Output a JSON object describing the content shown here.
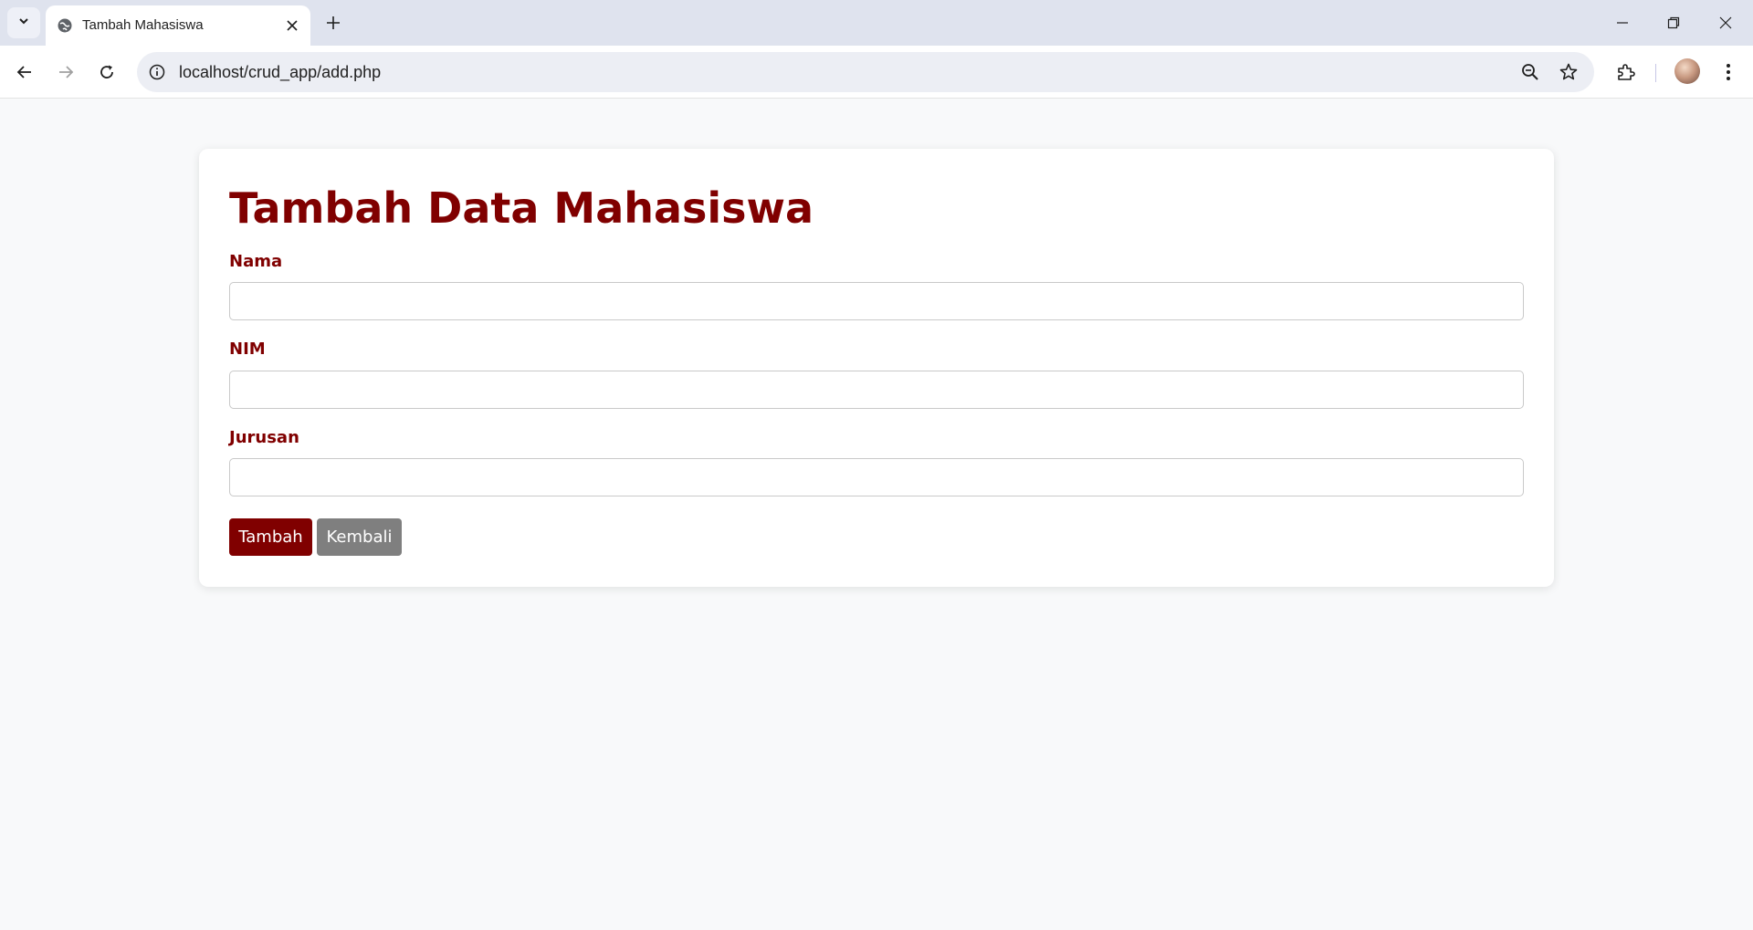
{
  "browser": {
    "tab_title": "Tambah Mahasiswa",
    "url": "localhost/crud_app/add.php"
  },
  "page": {
    "title": "Tambah Data Mahasiswa",
    "fields": [
      {
        "label": "Nama",
        "value": "",
        "placeholder": ""
      },
      {
        "label": "NIM",
        "value": "",
        "placeholder": ""
      },
      {
        "label": "Jurusan",
        "value": "",
        "placeholder": ""
      }
    ],
    "submit_label": "Tambah",
    "back_label": "Kembali"
  },
  "colors": {
    "accent": "#800000",
    "secondary_button": "#7f7f7f",
    "page_background": "#f8f9fa"
  },
  "icons": {
    "tab_search": "chevron-down-icon",
    "favicon": "globe-icon",
    "tab_close": "close-icon",
    "new_tab": "plus-icon",
    "back": "arrow-left-icon",
    "forward": "arrow-right-icon",
    "reload": "reload-icon",
    "site_info": "info-icon",
    "zoom": "zoom-out-icon",
    "bookmark": "star-icon",
    "extensions": "puzzle-icon",
    "menu": "kebab-menu-icon"
  }
}
